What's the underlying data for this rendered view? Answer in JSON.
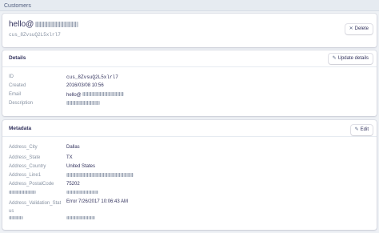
{
  "breadcrumb": {
    "title": "Customers"
  },
  "customer": {
    "name_prefix": "hello@",
    "id": "cus_8ZvsuQ2L5xlrl7",
    "delete_label": "Delete"
  },
  "details": {
    "title": "Details",
    "update_label": "Update details",
    "rows": [
      {
        "label": "ID",
        "value": "cus_8ZvsuQ2L5xlrl7"
      },
      {
        "label": "Created",
        "value": "2016/03/08 10:56"
      },
      {
        "label": "Email",
        "value": "hello@"
      },
      {
        "label": "Description",
        "value": ""
      }
    ]
  },
  "metadata": {
    "title": "Metadata",
    "edit_label": "Edit",
    "rows": [
      {
        "label": "Address_City",
        "value": "Dallas"
      },
      {
        "label": "Address_State",
        "value": "TX"
      },
      {
        "label": "Address_Country",
        "value": "United States"
      },
      {
        "label": "Address_Line1",
        "value": ""
      },
      {
        "label": "Address_PostalCode",
        "value": "75202"
      },
      {
        "label": "",
        "value": ""
      },
      {
        "label": "Address_Validation_Stat",
        "label2": "us",
        "value": "Error 7/26/2017 10:06:43 AM"
      },
      {
        "label": "",
        "value": ""
      }
    ]
  },
  "icons": {
    "delete": "close-icon",
    "update": "pencil-icon",
    "edit": "pencil-icon"
  }
}
